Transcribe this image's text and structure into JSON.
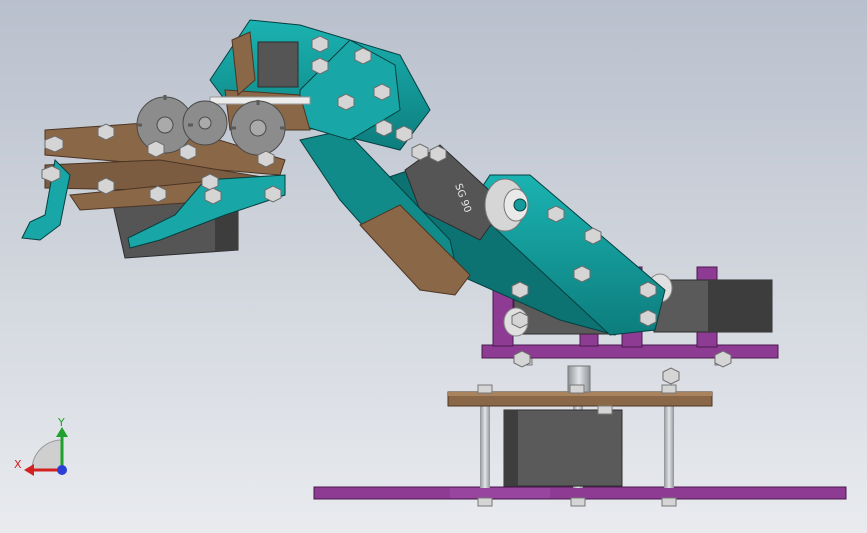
{
  "triad": {
    "x_label": "X",
    "y_label": "Y",
    "x_color": "#d42020",
    "y_color": "#1fa12e",
    "z_color": "#2a3fd6"
  },
  "colors": {
    "teal": "#149a9a",
    "teal_dark": "#0b6c6c",
    "wood": "#8a6747",
    "wood_dark": "#5e4430",
    "purple": "#8d3b93",
    "purple_dark": "#5d2461",
    "servo": "#555555",
    "servo_dark": "#333333",
    "gear": "#8c8c8c",
    "steel": "#b5b8bd",
    "nut": "#d5d5d5"
  },
  "servo_label": "SG 90"
}
